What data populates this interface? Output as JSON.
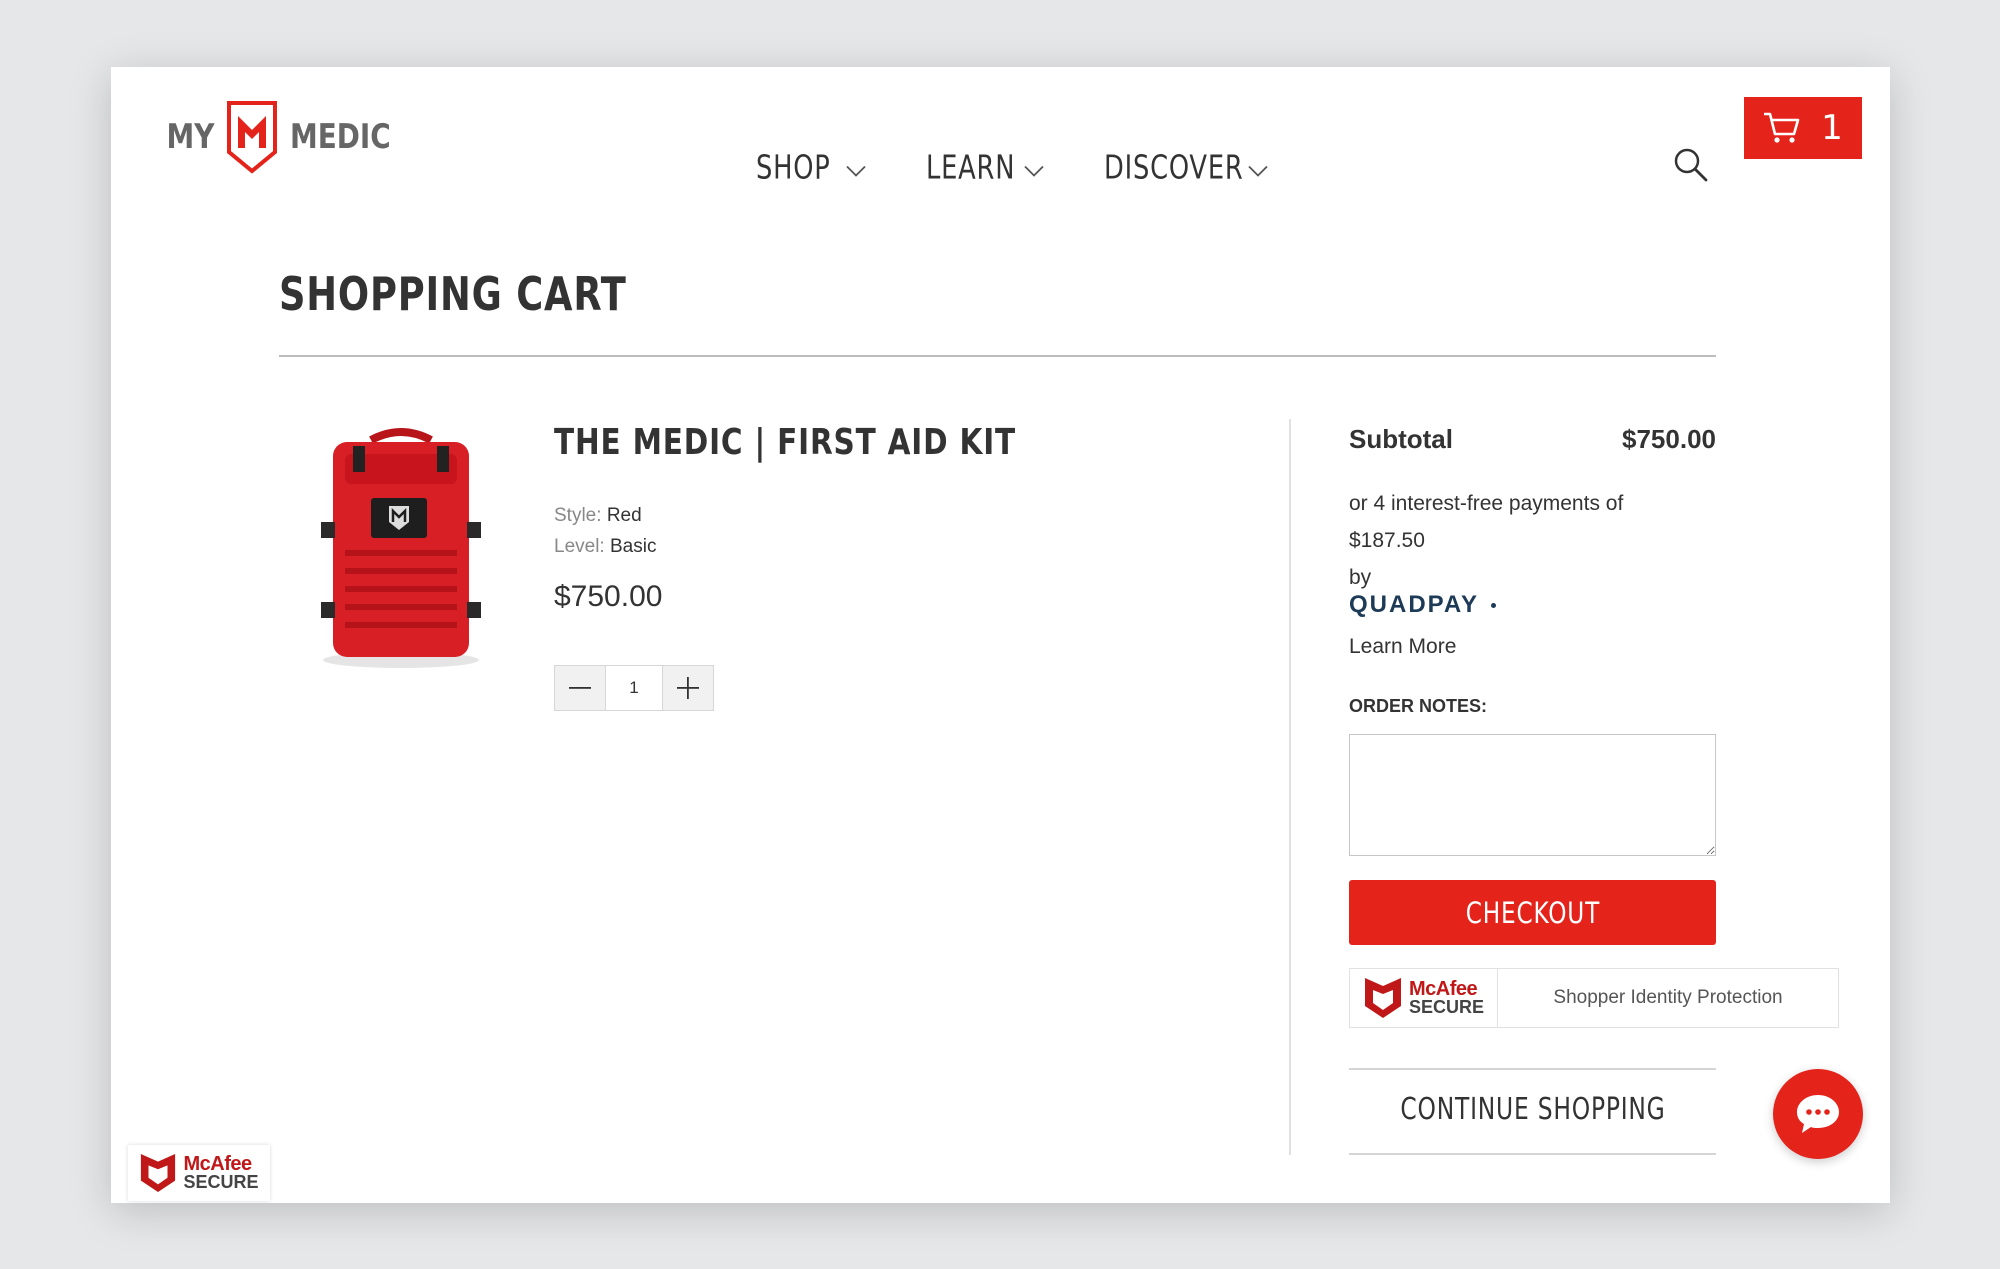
{
  "brand": {
    "left_word": "MY",
    "right_word": "MEDIC",
    "accent_color": "#e4231b"
  },
  "nav": {
    "items": [
      {
        "label": "SHOP"
      },
      {
        "label": "LEARN"
      },
      {
        "label": "DISCOVER"
      }
    ]
  },
  "header": {
    "search_icon": "search-icon",
    "cart_count": "1"
  },
  "page": {
    "title": "SHOPPING CART"
  },
  "cart": {
    "items": [
      {
        "name": "THE MEDIC | FIRST AID KIT",
        "style_label": "Style:",
        "style_value": "Red",
        "level_label": "Level:",
        "level_value": "Basic",
        "price": "$750.00",
        "quantity": "1"
      }
    ]
  },
  "summary": {
    "subtotal_label": "Subtotal",
    "subtotal_value": "$750.00",
    "installments_line1": "or 4 interest-free payments of",
    "installments_amount": "$187.50",
    "installments_by": "by",
    "quadpay_label": "QUADPAY",
    "learn_more": "Learn More",
    "order_notes_label": "ORDER NOTES:",
    "order_notes_value": "",
    "checkout_label": "CHECKOUT",
    "mcafee_line1": "McAfee",
    "mcafee_line2": "SECURE",
    "shopper_protection": "Shopper Identity Protection",
    "continue_label": "CONTINUE SHOPPING"
  },
  "badge": {
    "line1": "McAfee",
    "line2": "SECURE"
  }
}
